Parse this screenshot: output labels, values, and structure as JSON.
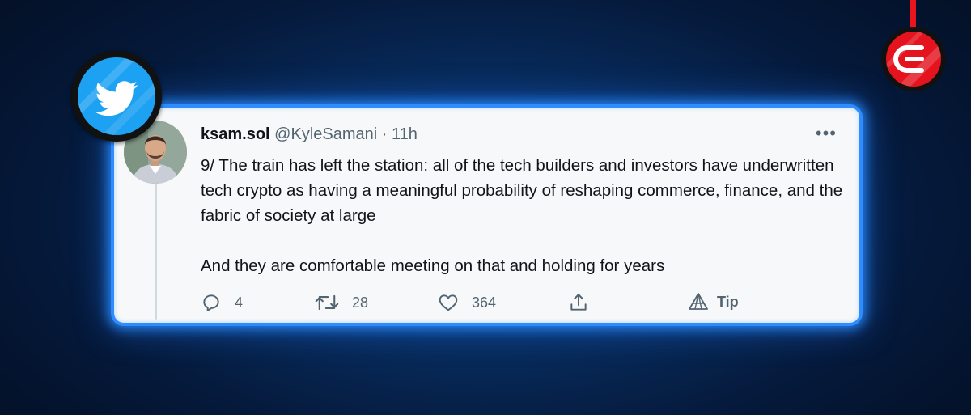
{
  "tweet": {
    "display_name": "ksam.sol",
    "handle": "@KyleSamani",
    "separator": "·",
    "time": "11h",
    "more_label": "•••",
    "paragraphs": [
      "9/ The train has left the station: all of the tech builders and investors have underwritten tech crypto as having a meaningful probability of reshaping commerce, finance, and the fabric of society at large",
      "And they are comfortable meeting on that and holding for years"
    ]
  },
  "actions": {
    "replies": "4",
    "retweets": "28",
    "likes": "364",
    "tip_label": "Tip"
  },
  "icons": {
    "reply": "reply-icon",
    "retweet": "retweet-icon",
    "like": "heart-icon",
    "share": "share-icon",
    "tip": "tip-icon",
    "platform": "twitter-bird-icon",
    "brand": "brand-logo-icon"
  },
  "colors": {
    "card_border": "#2f8cff",
    "twitter_blue": "#1da1f2",
    "brand_red": "#e5131d",
    "muted_text": "#536471"
  }
}
